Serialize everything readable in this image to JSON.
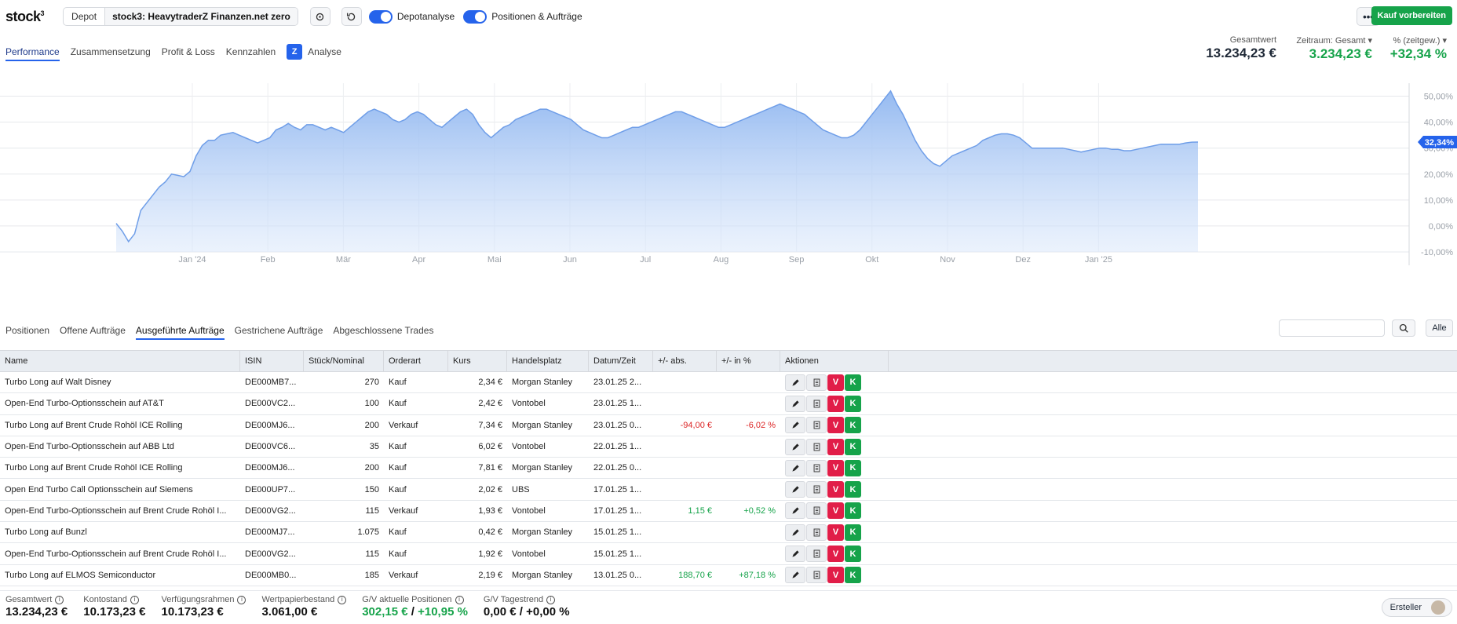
{
  "app": {
    "logo": "stock",
    "logo_sup": "3"
  },
  "topbar": {
    "depot_label": "Depot",
    "depot_name": "stock3: HeavytraderZ Finanzen.net zero",
    "toggle1_label": "Depotanalyse",
    "toggle2_label": "Positionen & Aufträge",
    "more_label": "•••",
    "buy_label": "Kauf vorbereiten"
  },
  "perf_tabs": {
    "performance": "Performance",
    "zusammensetzung": "Zusammensetzung",
    "pnl": "Profit & Loss",
    "kennzahlen": "Kennzahlen",
    "analyse": "Analyse"
  },
  "kpis": {
    "gesamtwert_label": "Gesamtwert",
    "gesamtwert_value": "13.234,23 €",
    "zeitraum_label": "Zeitraum: Gesamt ▾",
    "zeitraum_value": "3.234,23 €",
    "pct_label": "% (zeitgew.) ▾",
    "pct_value": "+32,34 %"
  },
  "chart_data": {
    "type": "area",
    "x_ticks": [
      "Jan '24",
      "Feb",
      "Mär",
      "Apr",
      "Mai",
      "Jun",
      "Jul",
      "Aug",
      "Sep",
      "Okt",
      "Nov",
      "Dez",
      "Jan '25"
    ],
    "y_ticks": [
      "50,00%",
      "40,00%",
      "30,00%",
      "20,00%",
      "10,00%",
      "0,00%",
      "-10,00%"
    ],
    "ylim": [
      -10,
      55
    ],
    "current_label": "32,34%",
    "values": [
      1,
      -2,
      -6,
      -3,
      6,
      9,
      12,
      15,
      17,
      20,
      19.5,
      19,
      21,
      27,
      31,
      33,
      33,
      35,
      35.5,
      36,
      35,
      34,
      33,
      32,
      33,
      34,
      37,
      38,
      39.5,
      38,
      37,
      39,
      39,
      38,
      37,
      38,
      37,
      36,
      38,
      40,
      42,
      44,
      45,
      44,
      43,
      41,
      40,
      41,
      43,
      44,
      43,
      41,
      39,
      38,
      40,
      42,
      44,
      45,
      43,
      39,
      36,
      34,
      36,
      38,
      39,
      41,
      42,
      43,
      44,
      45,
      45,
      44,
      43,
      42,
      41,
      39,
      37,
      36,
      35,
      34,
      34,
      35,
      36,
      37,
      38,
      38,
      39,
      40,
      41,
      42,
      43,
      44,
      44,
      43,
      42,
      41,
      40,
      39,
      38,
      38,
      39,
      40,
      41,
      42,
      43,
      44,
      45,
      46,
      47,
      46,
      45,
      44,
      43,
      41,
      39,
      37,
      36,
      35,
      34,
      34,
      35,
      37,
      40,
      43,
      46,
      49,
      52,
      47,
      43,
      38,
      33,
      29,
      26,
      24,
      23,
      25,
      27,
      28,
      29,
      30,
      31,
      33,
      34,
      35,
      35.5,
      35.5,
      35,
      34,
      32,
      30,
      30,
      30,
      30,
      30,
      30,
      29.5,
      29,
      28.5,
      29,
      29.5,
      30,
      30,
      29.5,
      29.5,
      29,
      29,
      29.5,
      30,
      30.5,
      31,
      31.5,
      31.5,
      31.5,
      31.5,
      32,
      32.3,
      32.34
    ],
    "values_note": "approximate daily series from Jan '24 to late Jan '25 (time-weighted performance in %)"
  },
  "order_tabs": {
    "positionen": "Positionen",
    "offene": "Offene Aufträge",
    "ausgefuehrte": "Ausgeführte Aufträge",
    "gestrichene": "Gestrichene Aufträge",
    "abgeschlossene": "Abgeschlossene Trades"
  },
  "search": {
    "placeholder": "",
    "alle_label": "Alle"
  },
  "table": {
    "headers": {
      "name": "Name",
      "isin": "ISIN",
      "qty": "Stück/Nominal",
      "type": "Orderart",
      "kurs": "Kurs",
      "place": "Handelsplatz",
      "date": "Datum/Zeit",
      "abs": "+/- abs.",
      "pct": "+/- in %",
      "actions": "Aktionen"
    },
    "action_labels": {
      "sell": "V",
      "buy": "K"
    },
    "rows": [
      {
        "name": "Turbo Long auf Walt Disney",
        "isin": "DE000MB7...",
        "qty": "270",
        "type": "Kauf",
        "kurs": "2,34 €",
        "place": "Morgan Stanley",
        "date": "23.01.25 2...",
        "abs": "",
        "pct": "",
        "tone": ""
      },
      {
        "name": "Open-End Turbo-Optionsschein auf AT&T",
        "isin": "DE000VC2...",
        "qty": "100",
        "type": "Kauf",
        "kurs": "2,42 €",
        "place": "Vontobel",
        "date": "23.01.25 1...",
        "abs": "",
        "pct": "",
        "tone": ""
      },
      {
        "name": "Turbo Long auf Brent Crude Rohöl ICE Rolling",
        "isin": "DE000MJ6...",
        "qty": "200",
        "type": "Verkauf",
        "kurs": "7,34 €",
        "place": "Morgan Stanley",
        "date": "23.01.25 0...",
        "abs": "-94,00 €",
        "pct": "-6,02 %",
        "tone": "red"
      },
      {
        "name": "Open-End Turbo-Optionsschein auf ABB Ltd",
        "isin": "DE000VC6...",
        "qty": "35",
        "type": "Kauf",
        "kurs": "6,02 €",
        "place": "Vontobel",
        "date": "22.01.25 1...",
        "abs": "",
        "pct": "",
        "tone": ""
      },
      {
        "name": "Turbo Long auf Brent Crude Rohöl ICE Rolling",
        "isin": "DE000MJ6...",
        "qty": "200",
        "type": "Kauf",
        "kurs": "7,81 €",
        "place": "Morgan Stanley",
        "date": "22.01.25 0...",
        "abs": "",
        "pct": "",
        "tone": ""
      },
      {
        "name": "Open End Turbo Call Optionsschein auf Siemens",
        "isin": "DE000UP7...",
        "qty": "150",
        "type": "Kauf",
        "kurs": "2,02 €",
        "place": "UBS",
        "date": "17.01.25 1...",
        "abs": "",
        "pct": "",
        "tone": ""
      },
      {
        "name": "Open-End Turbo-Optionsschein auf Brent Crude Rohöl I...",
        "isin": "DE000VG2...",
        "qty": "115",
        "type": "Verkauf",
        "kurs": "1,93 €",
        "place": "Vontobel",
        "date": "17.01.25 1...",
        "abs": "1,15 €",
        "pct": "+0,52 %",
        "tone": "green"
      },
      {
        "name": "Turbo Long auf Bunzl",
        "isin": "DE000MJ7...",
        "qty": "1.075",
        "type": "Kauf",
        "kurs": "0,42 €",
        "place": "Morgan Stanley",
        "date": "15.01.25 1...",
        "abs": "",
        "pct": "",
        "tone": ""
      },
      {
        "name": "Open-End Turbo-Optionsschein auf Brent Crude Rohöl I...",
        "isin": "DE000VG2...",
        "qty": "115",
        "type": "Kauf",
        "kurs": "1,92 €",
        "place": "Vontobel",
        "date": "15.01.25 1...",
        "abs": "",
        "pct": "",
        "tone": ""
      },
      {
        "name": "Turbo Long auf ELMOS Semiconductor",
        "isin": "DE000MB0...",
        "qty": "185",
        "type": "Verkauf",
        "kurs": "2,19 €",
        "place": "Morgan Stanley",
        "date": "13.01.25 0...",
        "abs": "188,70 €",
        "pct": "+87,18 %",
        "tone": "green"
      }
    ]
  },
  "footer": {
    "gesamtwert_label": "Gesamtwert",
    "gesamtwert_value": "13.234,23 €",
    "konto_label": "Kontostand",
    "konto_value": "10.173,23 €",
    "verf_label": "Verfügungsrahmen",
    "verf_value": "10.173,23 €",
    "wp_label": "Wertpapierbestand",
    "wp_value": "3.061,00 €",
    "gv_label": "G/V aktuelle Positionen",
    "gv_abs": "302,15 €",
    "gv_sep": " / ",
    "gv_pct": "+10,95 %",
    "tag_label": "G/V Tagestrend",
    "tag_value": "0,00 € / +0,00 %",
    "creator_label": "Ersteller"
  },
  "colors": {
    "accent": "#2563eb",
    "positive": "#16a34a",
    "negative": "#dc2626",
    "chart_line": "#6f9ee8",
    "chart_fill": "#a9c7f5"
  }
}
